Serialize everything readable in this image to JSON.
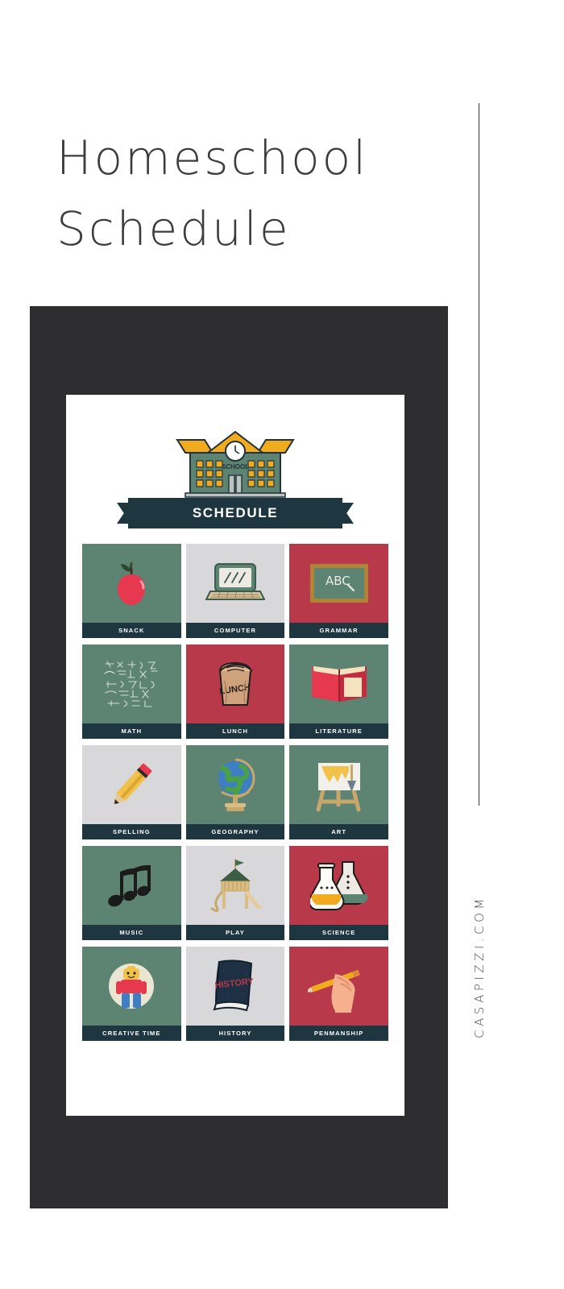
{
  "page": {
    "title": "Homeschool\nSchedule",
    "site_url": "CASAPIZZI.COM"
  },
  "colors": {
    "frame": "#2e2e30",
    "navy": "#1d3640",
    "green": "#5d8373",
    "gray": "#d8d8da",
    "red": "#b8394a",
    "yellow": "#f0ab1e",
    "title_text": "#3c3c3e"
  },
  "sheet": {
    "header": {
      "icon": "school-building-icon",
      "building_text": "SCHOOL",
      "ribbon_label": "SCHEDULE"
    },
    "cards": [
      {
        "label": "SNACK",
        "bg": "green",
        "icon": "apple-icon"
      },
      {
        "label": "COMPUTER",
        "bg": "gray",
        "icon": "laptop-icon"
      },
      {
        "label": "GRAMMAR",
        "bg": "red",
        "icon": "chalkboard-abc-icon"
      },
      {
        "label": "MATH",
        "bg": "green",
        "icon": "equations-chalkboard-icon"
      },
      {
        "label": "LUNCH",
        "bg": "red",
        "icon": "lunch-bag-icon"
      },
      {
        "label": "LITERATURE",
        "bg": "green",
        "icon": "open-book-icon"
      },
      {
        "label": "SPELLING",
        "bg": "gray",
        "icon": "pencil-icon"
      },
      {
        "label": "GEOGRAPHY",
        "bg": "green",
        "icon": "globe-icon"
      },
      {
        "label": "ART",
        "bg": "green",
        "icon": "easel-icon"
      },
      {
        "label": "MUSIC",
        "bg": "green",
        "icon": "music-notes-icon"
      },
      {
        "label": "PLAY",
        "bg": "gray",
        "icon": "playground-icon"
      },
      {
        "label": "SCIENCE",
        "bg": "red",
        "icon": "flasks-icon"
      },
      {
        "label": "CREATIVE TIME",
        "bg": "green",
        "icon": "lego-figure-icon"
      },
      {
        "label": "HISTORY",
        "bg": "gray",
        "icon": "history-book-icon"
      },
      {
        "label": "PENMANSHIP",
        "bg": "red",
        "icon": "writing-hand-icon"
      }
    ],
    "card_art_text": {
      "grammar": "ABC",
      "lunch": "LUNCH",
      "history": "HISTORY"
    }
  }
}
